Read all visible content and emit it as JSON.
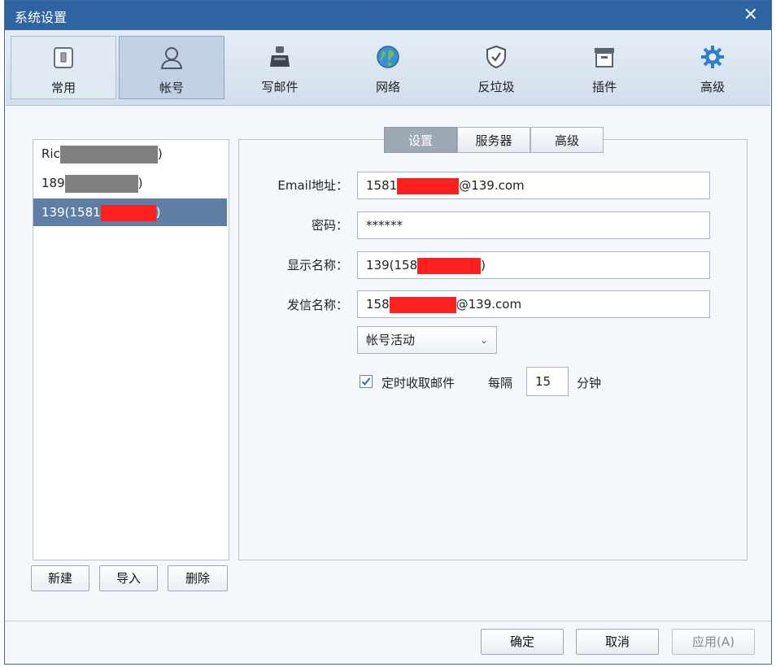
{
  "window": {
    "title": "系统设置"
  },
  "toolbar": {
    "items": [
      {
        "label": "常用",
        "icon": "settings-box-icon"
      },
      {
        "label": "帐号",
        "icon": "user-icon"
      },
      {
        "label": "写邮件",
        "icon": "compose-icon"
      },
      {
        "label": "网络",
        "icon": "globe-icon"
      },
      {
        "label": "反垃圾",
        "icon": "shield-icon"
      },
      {
        "label": "插件",
        "icon": "plugin-box-icon"
      },
      {
        "label": "高级",
        "icon": "gear-icon"
      }
    ]
  },
  "accounts": {
    "items": [
      {
        "prefix": "Ric",
        "suffix": ")"
      },
      {
        "prefix": "189",
        "suffix": ")"
      },
      {
        "prefix": "139(1581",
        "suffix": ")"
      }
    ],
    "buttons": {
      "new": "新建",
      "import": "导入",
      "delete": "删除"
    }
  },
  "tabs": {
    "settings": "设置",
    "server": "服务器",
    "advanced": "高级"
  },
  "form": {
    "email_label": "Email地址：",
    "email_prefix": "1581",
    "email_suffix": "@139.com",
    "password_label": "密码：",
    "password_value": "******",
    "display_label": "显示名称：",
    "display_prefix": "139(158",
    "display_suffix": ")",
    "sender_label": "发信名称：",
    "sender_prefix": "158",
    "sender_suffix": "@139.com",
    "status_select": "帐号活动",
    "fetch_label": "定时收取邮件",
    "every_label": "每隔",
    "interval_value": "15",
    "minutes_label": "分钟"
  },
  "footer": {
    "ok": "确定",
    "cancel": "取消",
    "apply": "应用(A)"
  },
  "colors": {
    "titlebar": "#2f63a1",
    "selected_row": "#5f7ea3",
    "redaction_red": "#ff1f1f",
    "redaction_gray": "#808080"
  }
}
